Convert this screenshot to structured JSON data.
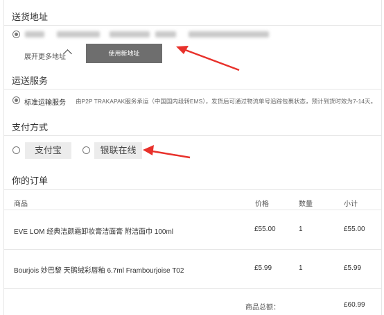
{
  "shipping_address": {
    "title": "送货地址",
    "expand_label": "展开更多地址",
    "new_address_button": "使用新地址"
  },
  "delivery": {
    "title": "运送服务",
    "option_label": "标准运输服务",
    "description": "由P2P TRAKAPAK服务承运（中国国内段转EMS），发货后可通过物流单号追踪包裹状态，预计到货时效为7-14天。"
  },
  "payment": {
    "title": "支付方式",
    "options": [
      "支付宝",
      "银联在线"
    ]
  },
  "order": {
    "title": "你的订单",
    "columns": {
      "product": "商品",
      "price": "价格",
      "qty": "数量",
      "subtotal": "小计"
    },
    "items": [
      {
        "product": "EVE LOM 经典洁颜霜卸妆膏洁面膏 附洁面巾 100ml",
        "price": "£55.00",
        "qty": "1",
        "subtotal": "£55.00"
      },
      {
        "product": "Bourjois 妙巴黎 天鹅绒彩唇釉 6.7ml Frambourjoise T02",
        "price": "£5.99",
        "qty": "1",
        "subtotal": "£5.99"
      }
    ],
    "total_label": "商品总额：",
    "total_value": "£60.99"
  },
  "colors": {
    "arrow": "#e8312b",
    "button_dark": "#6e6e6e"
  }
}
